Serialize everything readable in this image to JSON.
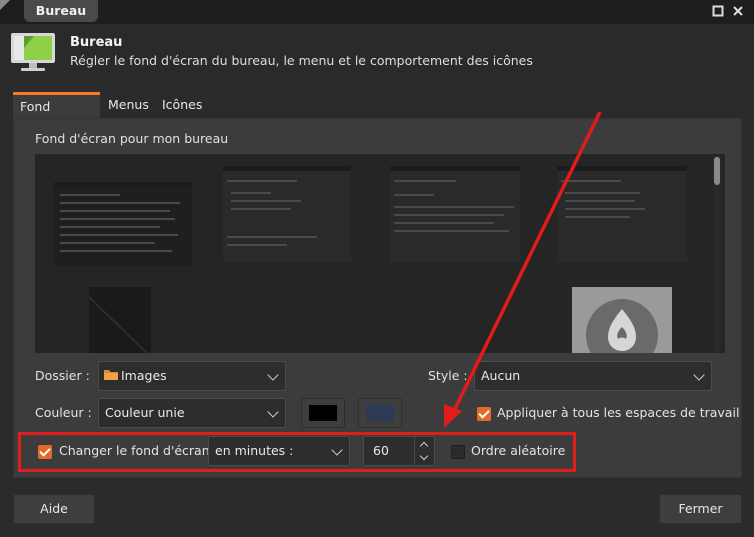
{
  "window": {
    "title": "Bureau",
    "controls": {
      "maximize_icon": "maximize-icon",
      "close_icon": "close-icon"
    }
  },
  "header": {
    "title": "Bureau",
    "subtitle": "Régler le fond d'écran du bureau, le menu et le comportement des icônes",
    "icon": "desktop-monitor-icon"
  },
  "tabs": [
    {
      "label": "Fond d'écran",
      "active": true
    },
    {
      "label": "Menus",
      "active": false
    },
    {
      "label": "Icônes",
      "active": false
    }
  ],
  "wallpaper": {
    "heading": "Fond d'écran pour mon bureau",
    "folder_label": "Dossier :",
    "folder_value": "Images",
    "folder_icon": "folder-icon",
    "style_label": "Style :",
    "style_value": "Aucun",
    "color_label": "Couleur :",
    "color_value": "Couleur unie",
    "color_swatches": [
      "#000000",
      "#2d3a56"
    ],
    "apply_all_label": "Appliquer à tous les espaces de travail",
    "apply_all_checked": true
  },
  "change": {
    "label": "Changer le fond d'écran",
    "checked": true,
    "unit_value": "en minutes :",
    "interval": "60",
    "random_label": "Ordre aléatoire",
    "random_checked": false
  },
  "footer": {
    "help_label": "Aide",
    "close_label": "Fermer"
  },
  "annotation": {
    "color": "#e21b1b"
  },
  "theme": {
    "accent": "#e06b2a"
  }
}
